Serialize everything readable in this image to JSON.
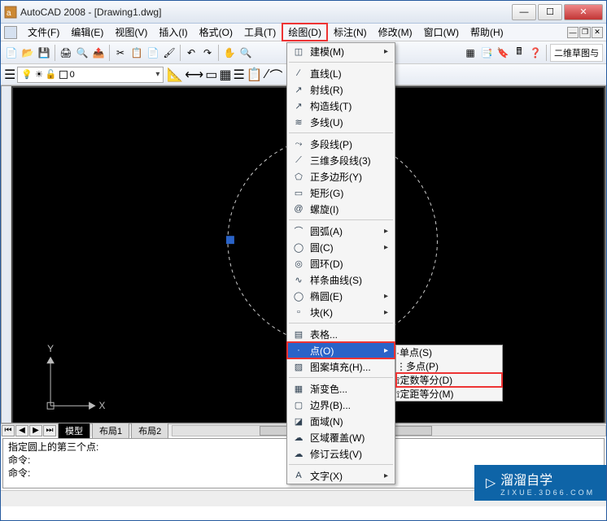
{
  "title": "AutoCAD 2008 - [Drawing1.dwg]",
  "menubar": {
    "items": [
      "文件(F)",
      "编辑(E)",
      "视图(V)",
      "插入(I)",
      "格式(O)",
      "工具(T)",
      "绘图(D)",
      "标注(N)",
      "修改(M)",
      "窗口(W)",
      "帮助(H)"
    ],
    "highlight_index": 6
  },
  "toolbar_right_button": "二维草图与",
  "layerbar": {
    "current": "0"
  },
  "canvas": {
    "axes": {
      "x_label": "X",
      "y_label": "Y"
    }
  },
  "tabs": {
    "items": [
      "模型",
      "布局1",
      "布局2"
    ],
    "active_index": 0
  },
  "cmd": {
    "lines": [
      "指定圆上的第三个点:",
      "命令:",
      "命令:"
    ]
  },
  "dropdown": {
    "groups": [
      [
        {
          "icon": "◫",
          "label": "建模(M)",
          "sub": true
        }
      ],
      [
        {
          "icon": "∕",
          "label": "直线(L)"
        },
        {
          "icon": "↗",
          "label": "射线(R)"
        },
        {
          "icon": "↗",
          "label": "构造线(T)"
        },
        {
          "icon": "≋",
          "label": "多线(U)"
        }
      ],
      [
        {
          "icon": "⤳",
          "label": "多段线(P)"
        },
        {
          "icon": "⟋",
          "label": "三维多段线(3)"
        },
        {
          "icon": "⬠",
          "label": "正多边形(Y)"
        },
        {
          "icon": "▭",
          "label": "矩形(G)"
        },
        {
          "icon": "@",
          "label": "螺旋(I)"
        }
      ],
      [
        {
          "icon": "⌒",
          "label": "圆弧(A)",
          "sub": true
        },
        {
          "icon": "◯",
          "label": "圆(C)",
          "sub": true
        },
        {
          "icon": "◎",
          "label": "圆环(D)"
        },
        {
          "icon": "∿",
          "label": "样条曲线(S)"
        },
        {
          "icon": "◯",
          "label": "椭圆(E)",
          "sub": true
        },
        {
          "icon": "▫",
          "label": "块(K)",
          "sub": true
        }
      ],
      [
        {
          "icon": "▤",
          "label": "表格..."
        },
        {
          "icon": "·",
          "label": "点(O)",
          "sub": true,
          "selected": true,
          "red": true
        },
        {
          "icon": "▨",
          "label": "图案填充(H)..."
        }
      ],
      [
        {
          "icon": "▦",
          "label": "渐变色..."
        },
        {
          "icon": "▢",
          "label": "边界(B)..."
        },
        {
          "icon": "◪",
          "label": "面域(N)"
        },
        {
          "icon": "☁",
          "label": "区域覆盖(W)"
        },
        {
          "icon": "☁",
          "label": "修订云线(V)"
        }
      ],
      [
        {
          "icon": "A",
          "label": "文字(X)",
          "sub": true
        }
      ]
    ]
  },
  "submenu": {
    "items": [
      {
        "icon": "·",
        "label": "单点(S)"
      },
      {
        "icon": "⋮",
        "label": "多点(P)"
      }
    ],
    "items2": [
      {
        "icon": "⟟",
        "label": "定数等分(D)",
        "red": true
      },
      {
        "icon": "⟟",
        "label": "定距等分(M)"
      }
    ]
  },
  "watermark": {
    "brand": "溜溜自学",
    "domain": "ZIXUE.3D66.COM"
  }
}
